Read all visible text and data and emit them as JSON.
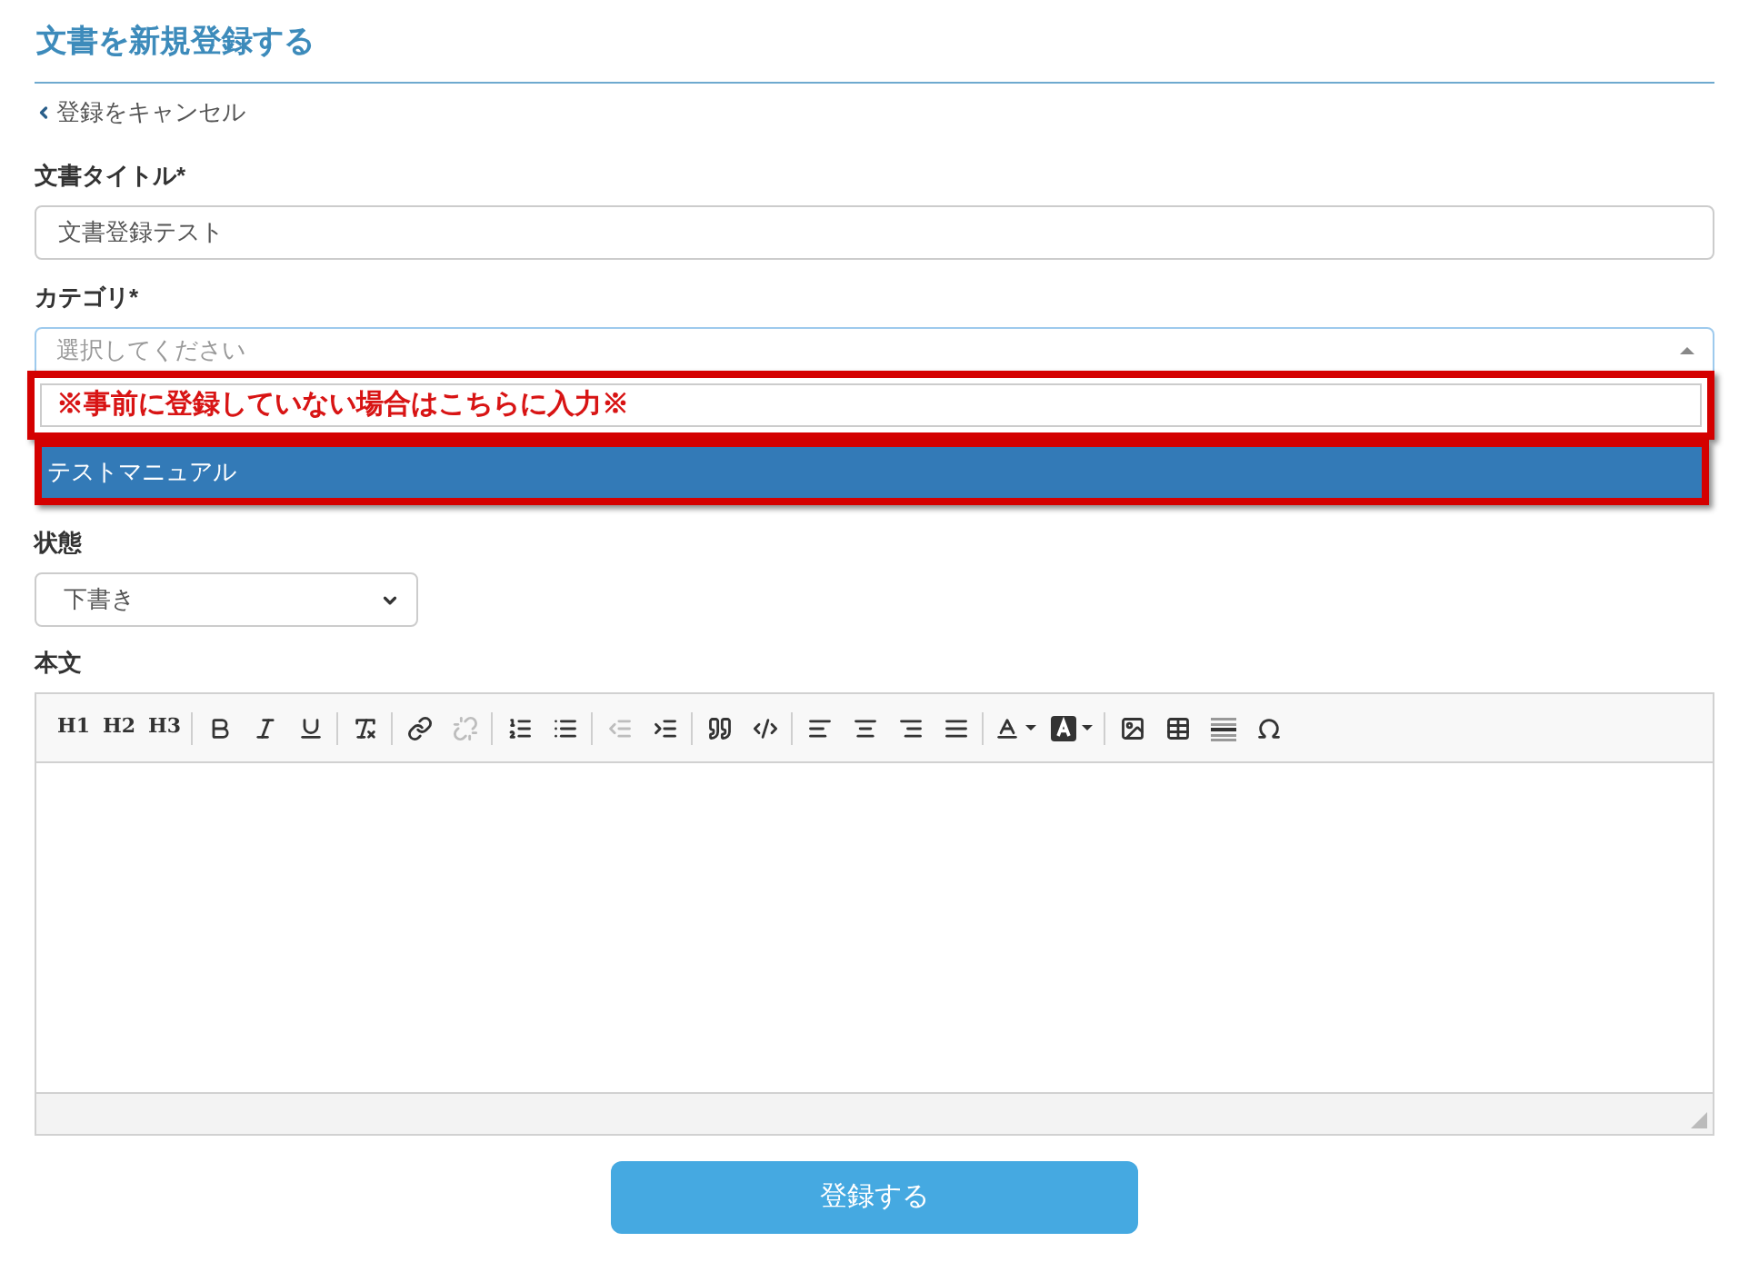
{
  "page": {
    "title": "文書を新規登録する",
    "cancel_link": "登録をキャンセル"
  },
  "title_field": {
    "label": "文書タイトル*",
    "value": "文書登録テスト"
  },
  "category_field": {
    "label": "カテゴリ*",
    "placeholder": "選択してください",
    "expanded": true,
    "dropdown": {
      "search": {
        "note": "※事前に登録していない場合はこちらに入力※",
        "marked": true
      },
      "options": [
        {
          "label": "テストマニュアル",
          "selected": true,
          "marked": true
        }
      ]
    }
  },
  "status_field": {
    "label": "状態",
    "value": "下書き"
  },
  "body_field": {
    "label": "本文",
    "toolbar": [
      [
        {
          "kind": "text",
          "label": "H1",
          "disabled": false
        },
        {
          "kind": "text",
          "label": "H2",
          "disabled": false
        },
        {
          "kind": "text",
          "label": "H3",
          "disabled": false
        }
      ],
      [
        {
          "kind": "icon",
          "disabled": false
        },
        {
          "kind": "icon",
          "disabled": false
        },
        {
          "kind": "icon",
          "disabled": false
        }
      ],
      [
        {
          "kind": "icon",
          "disabled": false
        }
      ],
      [
        {
          "kind": "icon",
          "disabled": false
        },
        {
          "kind": "icon",
          "disabled": true
        }
      ],
      [
        {
          "kind": "icon",
          "disabled": false
        },
        {
          "kind": "icon",
          "disabled": false
        }
      ],
      [
        {
          "kind": "icon",
          "disabled": true
        },
        {
          "kind": "icon",
          "disabled": false
        }
      ],
      [
        {
          "kind": "icon",
          "disabled": false
        },
        {
          "kind": "icon",
          "disabled": false
        }
      ],
      [
        {
          "kind": "icon",
          "disabled": false
        },
        {
          "kind": "icon",
          "disabled": false
        },
        {
          "kind": "icon",
          "disabled": false
        },
        {
          "kind": "icon",
          "disabled": false
        }
      ],
      [
        {
          "kind": "menu",
          "disabled": false
        },
        {
          "kind": "menu",
          "disabled": false
        }
      ],
      [
        {
          "kind": "icon",
          "disabled": false
        },
        {
          "kind": "icon",
          "disabled": false
        },
        {
          "kind": "icon",
          "disabled": false
        },
        {
          "kind": "icon",
          "disabled": false
        }
      ]
    ]
  },
  "submit_button": "登録する"
}
